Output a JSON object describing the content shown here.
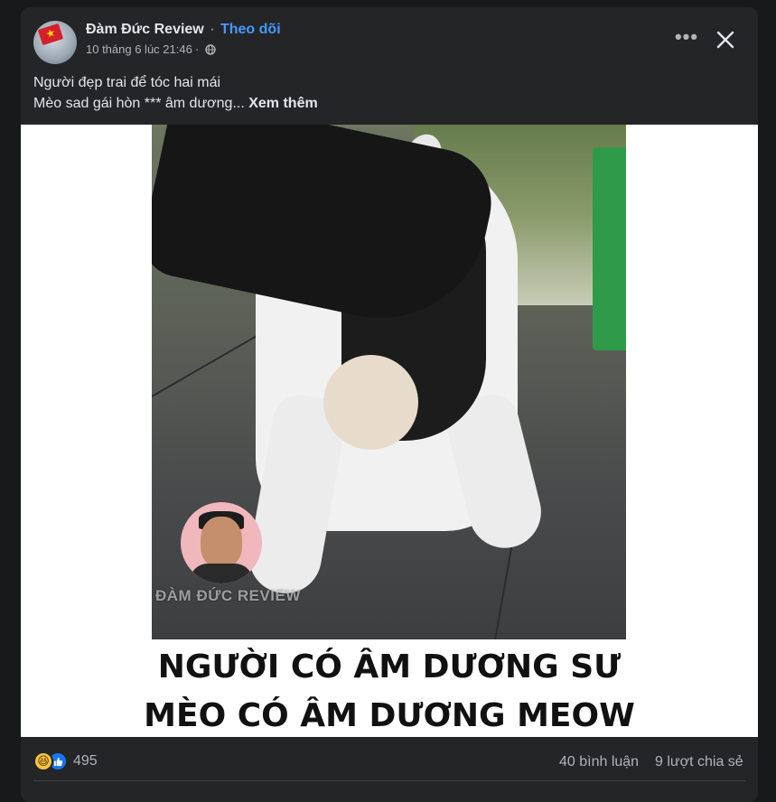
{
  "post": {
    "author": "Đàm Đức Review",
    "separator": "·",
    "follow_label": "Theo dõi",
    "timestamp": "10 tháng 6 lúc 21:46",
    "timestamp_separator": "·",
    "audience_icon": "globe-icon",
    "text_line1": "Người đẹp trai để tóc hai mái",
    "text_line2": "Mèo sad gái hòn *** âm dương...",
    "see_more_label": "Xem thêm"
  },
  "media": {
    "watermark": "ĐÀM ĐỨC REVIEW",
    "caption_line1": "NGƯỜI CÓ ÂM DƯƠNG SƯ",
    "caption_line2": "MÈO CÓ ÂM DƯƠNG MEOW"
  },
  "stats": {
    "reaction_icons": [
      "haha-icon",
      "like-icon"
    ],
    "reaction_count": "495",
    "comments": "40 bình luận",
    "shares": "9 lượt chia sẻ"
  },
  "colors": {
    "background": "#18191a",
    "card": "#242526",
    "primary_text": "#e4e6eb",
    "secondary_text": "#b0b3b8",
    "follow_link": "#4599ff",
    "like_blue": "#1877f2",
    "haha_yellow": "#f7c542"
  }
}
